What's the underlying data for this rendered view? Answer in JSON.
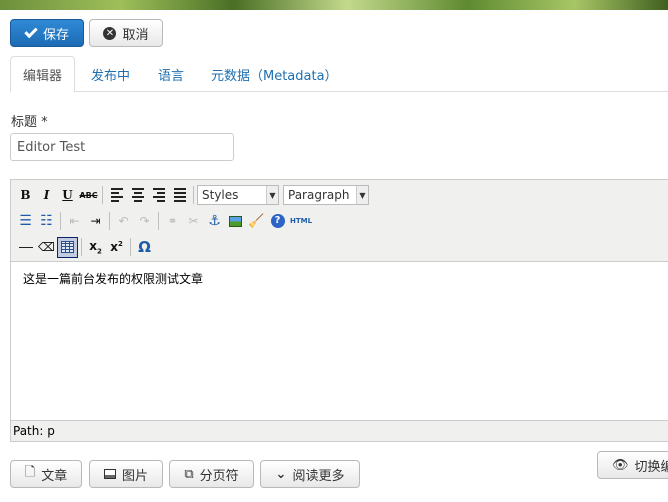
{
  "actions": {
    "save_label": "保存",
    "cancel_label": "取消"
  },
  "tabs": [
    {
      "label": "编辑器",
      "active": true
    },
    {
      "label": "发布中",
      "active": false
    },
    {
      "label": "语言",
      "active": false
    },
    {
      "label": "元数据（Metadata）",
      "active": false
    }
  ],
  "title_field": {
    "label": "标题 *",
    "value": "Editor Test"
  },
  "editor": {
    "styles_value": "Styles",
    "format_value": "Paragraph",
    "html_label": "HTML",
    "abc_label": "ABC",
    "content": "这是一篇前台发布的权限测试文章",
    "path_label": "Path: p"
  },
  "bottom_buttons": {
    "article": "文章",
    "image": "图片",
    "pagebreak": "分页符",
    "readmore": "阅读更多"
  },
  "toggle_label": "切换编",
  "colors": {
    "primary": "#1d6bb4",
    "link": "#1f6fb0",
    "border": "#cccccc"
  }
}
